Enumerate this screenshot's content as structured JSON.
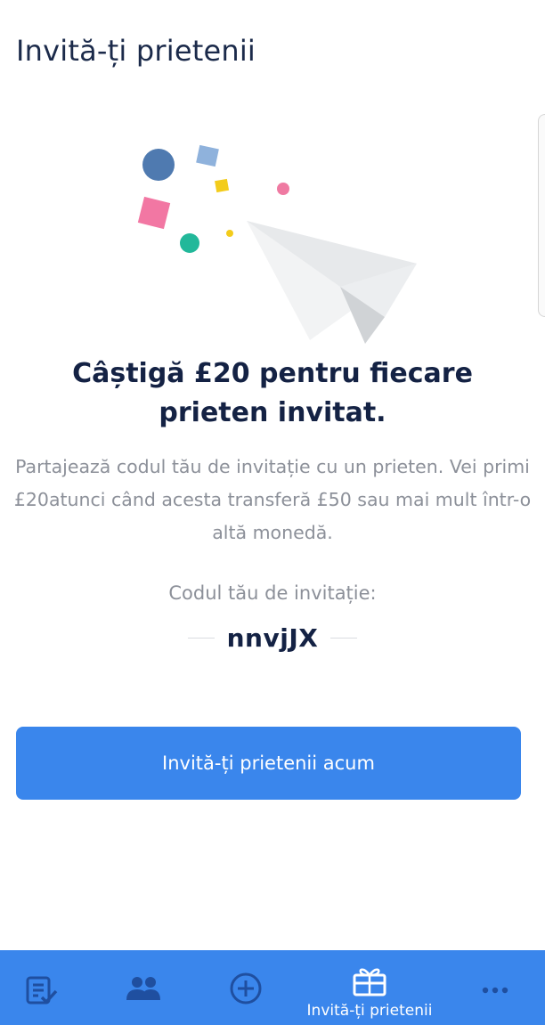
{
  "page": {
    "title": "Invită-ți prietenii"
  },
  "hero": {
    "headline_line1": "Câștigă £20 pentru fiecare",
    "headline_line2": "prieten invitat.",
    "description": "Partajează codul tău de invitație cu un prieten. Vei primi £20atunci când acesta transferă £50 sau mai mult într-o altă monedă."
  },
  "invite_code": {
    "label": "Codul tău de invitație:",
    "value": "nnvjJX"
  },
  "cta": {
    "label": "Invită-ți prietenii acum"
  },
  "tab_bar": {
    "items": [
      {
        "icon": "activity-list-icon",
        "label": ""
      },
      {
        "icon": "recipients-icon",
        "label": ""
      },
      {
        "icon": "add-circle-icon",
        "label": ""
      },
      {
        "icon": "gift-icon",
        "label": "Invită-ți prietenii",
        "active": true
      },
      {
        "icon": "more-icon",
        "label": ""
      }
    ]
  },
  "colors": {
    "accent": "#3a86ec",
    "headline": "#142244",
    "muted_text": "#8c9099",
    "tab_icon_inactive": "#1f4fa0",
    "tab_icon_active": "#ffffff"
  }
}
